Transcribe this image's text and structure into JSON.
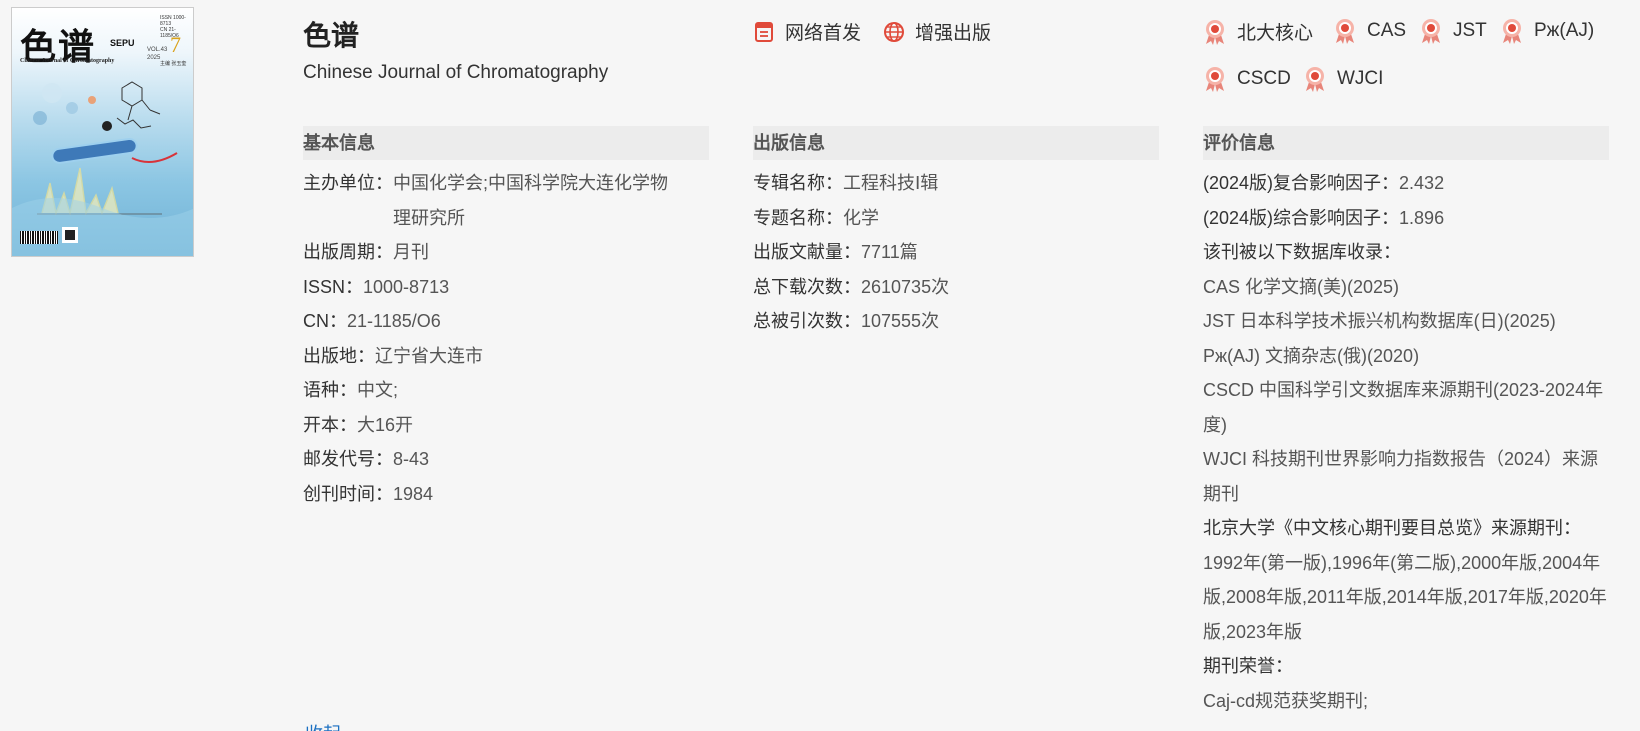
{
  "cover": {
    "title": "色谱",
    "sepu": "SEPU",
    "english": "Chinese Journal of Chromatography",
    "issn": "ISSN 1000-8713",
    "cn": "CN 21-1185/O6",
    "vol": "VOL.43",
    "year": "2025",
    "issue": "7",
    "editor": "主编 张玉奎"
  },
  "header": {
    "title": "色谱",
    "english_title": "Chinese Journal of Chromatography"
  },
  "features": [
    {
      "label": "网络首发",
      "icon": "document-icon"
    },
    {
      "label": "增强出版",
      "icon": "globe-icon"
    }
  ],
  "indexes": [
    {
      "label": "北大核心",
      "icon": "award-icon"
    },
    {
      "label": "CAS",
      "icon": "award-icon"
    },
    {
      "label": "JST",
      "icon": "award-icon"
    },
    {
      "label": "Рж(AJ)",
      "icon": "award-icon"
    },
    {
      "label": "CSCD",
      "icon": "award-icon"
    },
    {
      "label": "WJCI",
      "icon": "award-icon"
    }
  ],
  "basic": {
    "heading": "基本信息",
    "sponsor_label": "主办单位：",
    "sponsor_value": "中国化学会;中国科学院大连化学物理研究所",
    "period_label": "出版周期：",
    "period_value": "月刊",
    "issn_label": "ISSN：",
    "issn_value": "1000-8713",
    "cn_label": "CN：",
    "cn_value": "21-1185/O6",
    "place_label": "出版地：",
    "place_value": "辽宁省大连市",
    "lang_label": "语种：",
    "lang_value": "中文;",
    "format_label": "开本：",
    "format_value": "大16开",
    "postal_label": "邮发代号：",
    "postal_value": "8-43",
    "founded_label": "创刊时间：",
    "founded_value": "1984"
  },
  "publish": {
    "heading": "出版信息",
    "series_label": "专辑名称：",
    "series_value": "工程科技Ⅰ辑",
    "topic_label": "专题名称：",
    "topic_value": "化学",
    "docs_label": "出版文献量：",
    "docs_value": "7711篇",
    "downloads_label": "总下载次数：",
    "downloads_value": "2610735次",
    "citations_label": "总被引次数：",
    "citations_value": "107555次"
  },
  "evaluation": {
    "heading": "评价信息",
    "if_composite_label": "(2024版)复合影响因子：",
    "if_composite_value": "2.432",
    "if_comprehensive_label": "(2024版)综合影响因子：",
    "if_comprehensive_value": "1.896",
    "db_label": "该刊被以下数据库收录：",
    "db_cas": "CAS 化学文摘(美)(2025)",
    "db_jst": "JST 日本科学技术振兴机构数据库(日)(2025)",
    "db_aj": "Рж(AJ) 文摘杂志(俄)(2020)",
    "db_cscd": "CSCD 中国科学引文数据库来源期刊(2023-2024年度)",
    "db_wjci": "WJCI 科技期刊世界影响力指数报告（2024）来源期刊",
    "pku_label": "北京大学《中文核心期刊要目总览》来源期刊：",
    "pku_value": "1992年(第一版),1996年(第二版),2000年版,2004年版,2008年版,2011年版,2014年版,2017年版,2020年版,2023年版",
    "honor_label": "期刊荣誉：",
    "honor_value": "Caj-cd规范获奖期刊;"
  },
  "collapse_label": "收起",
  "colors": {
    "accent_red": "#e04a3a",
    "link_blue": "#1a6fc1"
  }
}
